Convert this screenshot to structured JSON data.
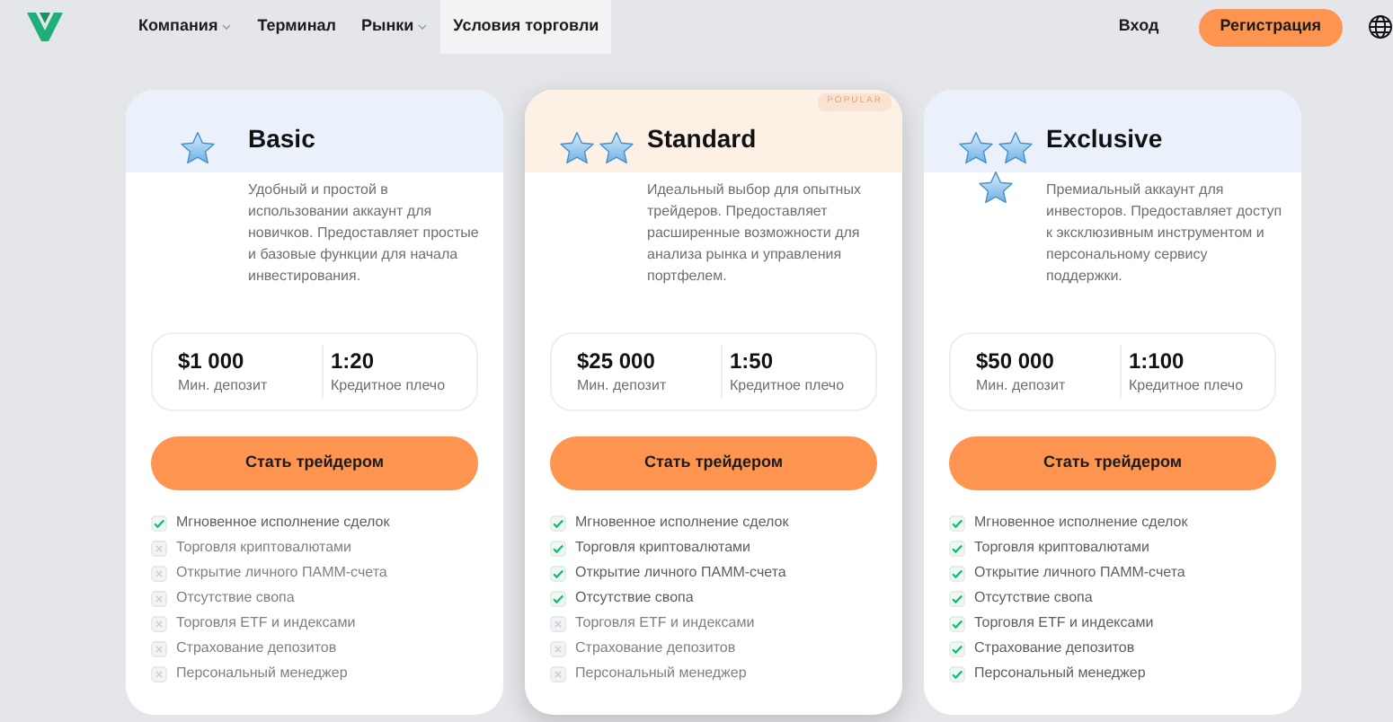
{
  "nav": {
    "items": [
      {
        "label": "Компания",
        "dropdown": true,
        "selected": false
      },
      {
        "label": "Терминал",
        "dropdown": false,
        "selected": false
      },
      {
        "label": "Рынки",
        "dropdown": true,
        "selected": false
      },
      {
        "label": "Условия торговли",
        "dropdown": false,
        "selected": true
      }
    ],
    "login": "Вход",
    "register": "Регистрация"
  },
  "plans": [
    {
      "title": "Basic",
      "icons": [
        {
          "kind": "star"
        }
      ],
      "selected": false,
      "description": "Удобный и простой в использовании аккаунт для новичков. Предоставляет простые и базовые функции для начала инвестирования.",
      "deposit": "$1 000",
      "deposit_label": "Мин. депозит",
      "leverage": "1:20",
      "leverage_label": "Кредитное плечо",
      "button": "Стать трейдером",
      "features": [
        {
          "label": "Мгновенное исполнение сделок",
          "checked": true
        },
        {
          "label": "Торговля криптовалютами",
          "checked": false
        },
        {
          "label": "Открытие личного ПАММ-счета",
          "checked": false
        },
        {
          "label": "Отсутствие свопа",
          "checked": false
        },
        {
          "label": "Торговля ETF и индексами",
          "checked": false
        },
        {
          "label": "Страхование депозитов",
          "checked": false
        },
        {
          "label": "Персональный менеджер",
          "checked": false
        }
      ]
    },
    {
      "title": "Standard",
      "icons": [
        {
          "kind": "star"
        },
        {
          "kind": "star"
        }
      ],
      "badge": "POPULAR",
      "selected": true,
      "description": "Идеальный выбор для опытных трейдеров. Предоставляет расширенные возможности для анализа рынка и управления портфелем.",
      "deposit": "$25 000",
      "deposit_label": "Мин. депозит",
      "leverage": "1:50",
      "leverage_label": "Кредитное плечо",
      "button": "Стать трейдером",
      "features": [
        {
          "label": "Мгновенное исполнение сделок",
          "checked": true
        },
        {
          "label": "Торговля криптовалютами",
          "checked": true
        },
        {
          "label": "Открытие личного ПАММ-счета",
          "checked": true
        },
        {
          "label": "Отсутствие свопа",
          "checked": true
        },
        {
          "label": "Торговля ETF и индексами",
          "checked": false
        },
        {
          "label": "Страхование депозитов",
          "checked": false
        },
        {
          "label": "Персональный менеджер",
          "checked": false
        }
      ]
    },
    {
      "title": "Exclusive",
      "icons": [
        {
          "kind": "star"
        },
        {
          "kind": "star"
        },
        {
          "kind": "star"
        }
      ],
      "selected": false,
      "description": "Премиальный аккаунт для инвесторов. Предоставляет доступ к эксклюзивным инструментом и персональному сервису поддержки.",
      "deposit": "$50 000",
      "deposit_label": "Мин. депозит",
      "leverage": "1:100",
      "leverage_label": "Кредитное плечо",
      "button": "Стать трейдером",
      "features": [
        {
          "label": "Мгновенное исполнение сделок",
          "checked": true
        },
        {
          "label": "Торговля криптовалютами",
          "checked": true
        },
        {
          "label": "Открытие личного ПАММ-счета",
          "checked": true
        },
        {
          "label": "Отсутствие свопа",
          "checked": true
        },
        {
          "label": "Торговля ETF и индексами",
          "checked": true
        },
        {
          "label": "Страхование депозитов",
          "checked": true
        },
        {
          "label": "Персональный менеджер",
          "checked": true
        }
      ]
    }
  ]
}
